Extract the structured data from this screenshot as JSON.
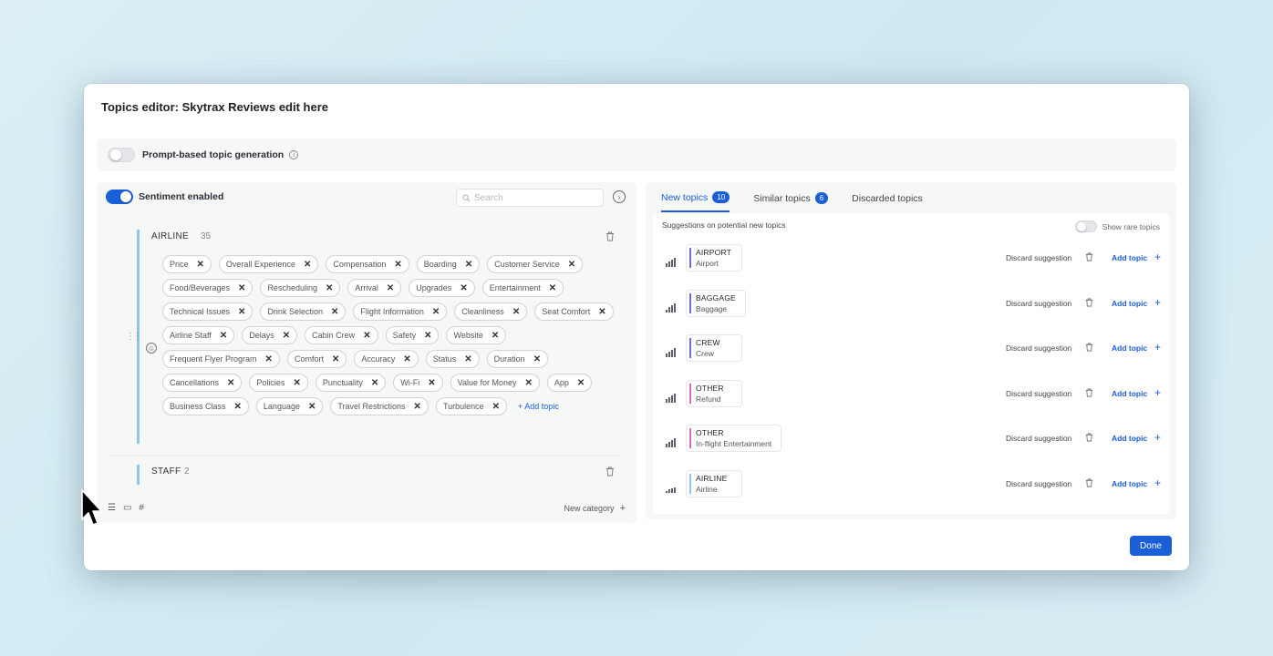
{
  "modal": {
    "title": "Topics editor: Skytrax Reviews edit here",
    "prompt_label": "Prompt-based topic generation",
    "info_icon": "ⓘ",
    "done_label": "Done"
  },
  "left": {
    "sentiment_label": "Sentiment enabled",
    "search_placeholder": "Search",
    "categories": [
      {
        "name": "AIRLINE",
        "count": "35",
        "topics": [
          "Price",
          "Overall Experience",
          "Compensation",
          "Boarding",
          "Customer Service",
          "Food/Beverages",
          "Rescheduling",
          "Arrival",
          "Upgrades",
          "Entertainment",
          "Technical Issues",
          "Drink Selection",
          "Flight Information",
          "Cleanliness",
          "Seat Comfort",
          "Airline Staff",
          "Delays",
          "Cabin Crew",
          "Safety",
          "Website",
          "Frequent Flyer Program",
          "Comfort",
          "Accuracy",
          "Status",
          "Duration",
          "Cancellations",
          "Policies",
          "Punctuality",
          "Wi-Fi",
          "Value for Money",
          "App",
          "Business Class",
          "Language",
          "Travel Restrictions",
          "Turbulence"
        ],
        "add_topic_label": "+ Add topic"
      },
      {
        "name": "STAFF",
        "count": "2"
      }
    ],
    "new_category_label": "New category",
    "plus": "+"
  },
  "right": {
    "tabs": [
      {
        "label": "New topics",
        "badge": "10"
      },
      {
        "label": "Similar topics",
        "badge": "6"
      },
      {
        "label": "Discarded topics"
      }
    ],
    "suggestions_title": "Suggestions on potential new topics",
    "show_rare_label": "Show rare topics",
    "discard_label": "Discard suggestion",
    "add_topic_label": "Add topic",
    "suggestions": [
      {
        "category": "AIRPORT",
        "name": "Airport",
        "color": "#6b6fd4"
      },
      {
        "category": "BAGGAGE",
        "name": "Baggage",
        "color": "#6b6fd4"
      },
      {
        "category": "CREW",
        "name": "Crew",
        "color": "#6b6fd4"
      },
      {
        "category": "OTHER",
        "name": "Refund",
        "color": "#d46bc9"
      },
      {
        "category": "OTHER",
        "name": "In-flight Entertainment",
        "color": "#d46bc9"
      },
      {
        "category": "AIRLINE",
        "name": "Airline",
        "color": "#8cc7ea"
      }
    ]
  }
}
